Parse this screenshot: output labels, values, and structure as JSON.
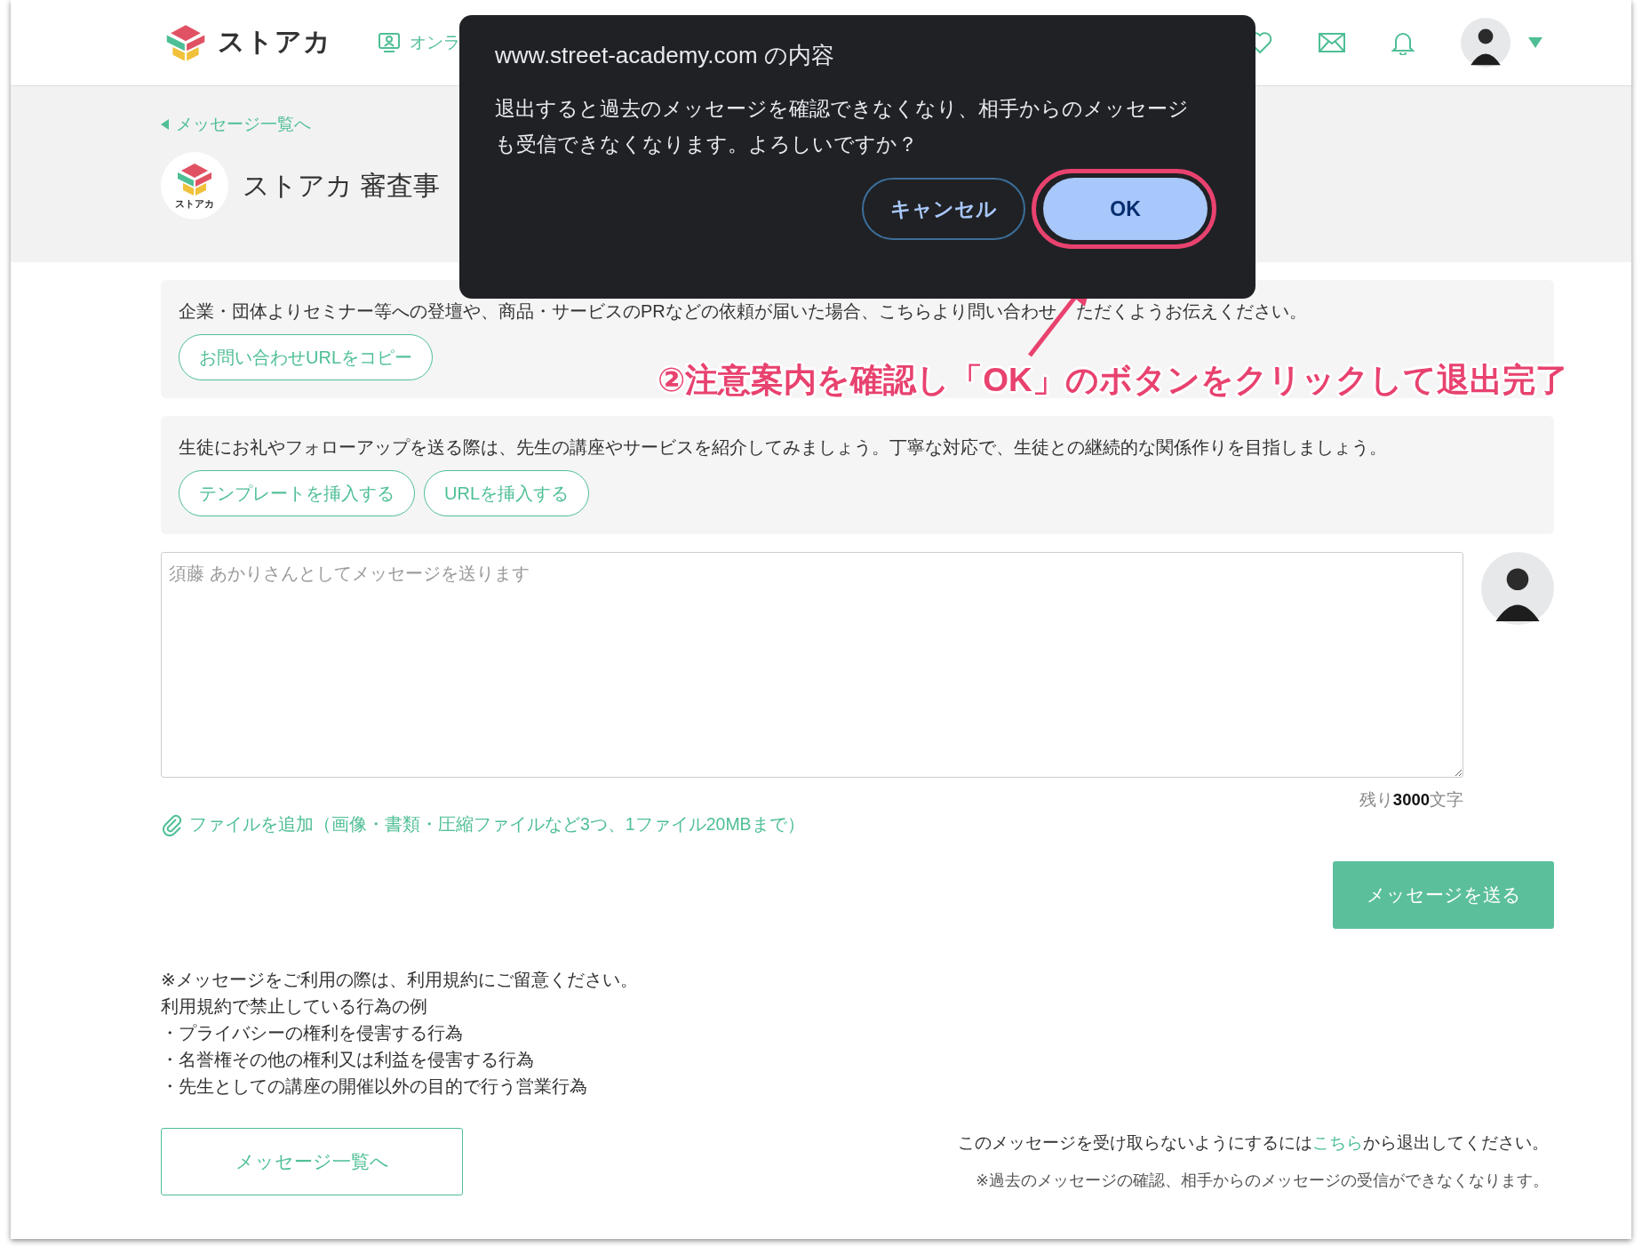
{
  "header": {
    "logo_text": "ストアカ",
    "nav_item": "オンラ"
  },
  "back_link": "メッセージ一覧へ",
  "room": {
    "avatar_label": "ストアカ",
    "title": "ストアカ 審査事"
  },
  "info_boxes": [
    {
      "text": "企業・団体よりセミナー等への登壇や、商品・サービスのPRなどの依頼が届いた場合、こちらより問い合わせ",
      "text_after_arrow": "ただくようお伝えください。",
      "buttons": [
        "お問い合わせURLをコピー"
      ]
    },
    {
      "text": "生徒にお礼やフォローアップを送る際は、先生の講座やサービスを紹介してみましょう。丁寧な対応で、生徒との継続的な関係作りを目指しましょう。",
      "buttons": [
        "テンプレートを挿入する",
        "URLを挿入する"
      ]
    }
  ],
  "composer": {
    "placeholder": "須藤 あかりさんとしてメッセージを送ります",
    "remaining": "残り**3000**文字",
    "attach_link": "ファイルを追加（画像・書類・圧縮ファイルなど3つ、1ファイル20MBまで）",
    "send_button": "メッセージを送る"
  },
  "notes": [
    "※メッセージをご利用の際は、利用規約にご留意ください。",
    "利用規約で禁止している行為の例",
    "・プライバシーの権利を侵害する行為",
    "・名誉権その他の権利又は利益を侵害する行為",
    "・先生としての講座の開催以外の目的で行う営業行為"
  ],
  "back_button": "メッセージ一覧へ",
  "leave": {
    "before": "このメッセージを受け取らないようにするには",
    "link": "こちら",
    "after": "から退出してください。",
    "note": "※過去のメッセージの確認、相手からのメッセージの受信ができなくなります。"
  },
  "dialog": {
    "title": "www.street-academy.com の内容",
    "message": "退出すると過去のメッセージを確認できなくなり、相手からのメッセージも受信できなくなります。よろしいですか？",
    "buttons": [
      {
        "label": "キャンセル",
        "kind": "secondary",
        "highlighted": false
      },
      {
        "label": "OK",
        "kind": "primary",
        "highlighted": true
      }
    ]
  },
  "annotation": {
    "text": "②注意案内を確認し「OK」のボタンをクリックして退出完了"
  }
}
